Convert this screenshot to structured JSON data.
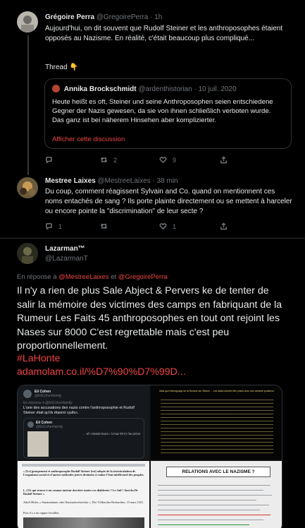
{
  "tweets": [
    {
      "name": "Grégoire Perra",
      "handle": "@GregoirePerra",
      "time": "1h",
      "text": "Aujourd'hui, on dit souvent que Rudolf Steiner et les anthroposophes étaient opposés au Nazisme. En réalité, c'était beaucoup plus compliqué...",
      "thread_label": "Thread 👇",
      "quote": {
        "name": "Annika Brockschmidt",
        "handle": "@ardenthistorian",
        "date": "10 juil. 2020",
        "text": "Heute heißt es oft, Steiner und seine Anthroposophen seien entschiedene Gegner der Nazis gewesen, da sie von ihnen schließlich verboten wurde. Das ganz ist bei näherem Hinsehen aber komplizierter.",
        "link": "Afficher cette discussion"
      },
      "actions": {
        "reply": "",
        "retweet": "2",
        "like": "9"
      }
    },
    {
      "name": "Mestree Laixes",
      "handle": "@MestreeLaixes",
      "time": "38 min",
      "text": "Du coup, comment réagissent Sylvain and Co. quand on mentionnent ces noms entachés de sang ? Ils porte plainte directement ou se mettent à harceler ou encore pointe la \"discrimination\" de leur secte ?",
      "actions": {
        "reply": "1",
        "retweet": "",
        "like": "1"
      }
    }
  ],
  "main_tweet": {
    "name": "Lazarman™",
    "handle": "@LazarmanT",
    "reply_prefix": "En réponse à",
    "reply_and": "et",
    "mention_1": "@MestreeLaixes",
    "mention_2": "@GregoirePerra",
    "text": "Il n'y a rien de plus Sale Abject & Pervers ke de tenter de salir la mémoire des victimes des camps en fabriquant de la Rumeur Les Faits 45 anthroposophes en tout ont rejoint les Nases sur 8000 C'est regrettable mais c'est peu proportionnellement.",
    "hashtag": "#LaHonte",
    "link": "adamolam.co.il/%D7%90%D7%99D..."
  },
  "media": {
    "tl": {
      "name": "Eli Cohen",
      "handle": "@EliCohenfamily",
      "reply": "En réponse à @EliCohenfamily",
      "text": "L'une des accusations des nazis contre l'anthroposophie et Rudolf Steiner était qu'ils étaient «juifs».",
      "inner_name": "Eli Cohen",
      "inner_handle": "@EliCohenfamily",
      "hebrew": "מכתבו של רודולף שטיינר / האנתרופוסופיה לא ..."
    },
    "tr": {
      "text": "Mais quel témoignage de la Rumeur sur Steiner ... Les dates doivent être prises avec une certaine prudence."
    },
    "bl": {
      "text": "« [Le] groupement et anthroposophe Rudolf Steiner [est] adepte de la triarticulation de l'organisme social et d'autres méthodes juives destinées à ruiner l'état intellectuel des peuples.",
      "text2": "[...] Et qui trouve-t-on comme moteur derrière toutes ces diableries ? Le Juif ! Ami du Dr Rudolf Steiner »",
      "author": "Adolf Hitler, « Staatsmänner oder Nationalverbrecher », Der Völkischer Beobachter, 15 mars 1921.",
      "footer": "Puis il y a un rapport lesallier."
    },
    "br": {
      "title": "RELATIONS AVEC LE NAZISME ?"
    }
  },
  "colors": {
    "background": "#000000",
    "accent": "#ef4444",
    "muted": "#71767b",
    "text": "#e7e9ea",
    "border": "#2f3336"
  }
}
